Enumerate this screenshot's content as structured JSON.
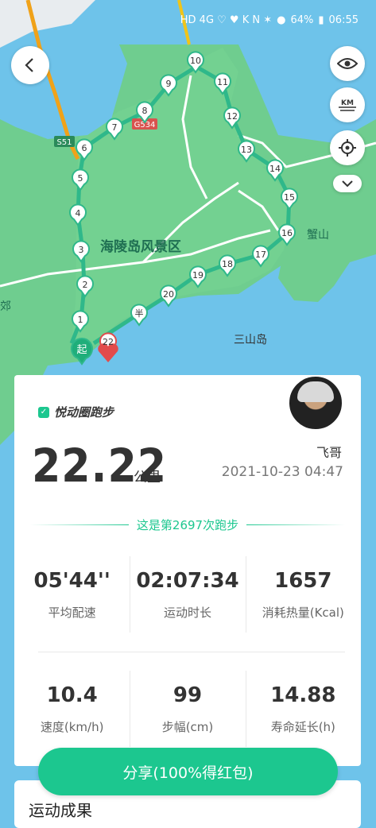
{
  "status_bar": {
    "left_labels": [
      "HD",
      "4G",
      "♡",
      "♥",
      "K",
      "N",
      "✶"
    ],
    "battery": "64%",
    "time": "06:55"
  },
  "map": {
    "route_labels": [
      "起",
      "1",
      "2",
      "3",
      "4",
      "5",
      "6",
      "7",
      "8",
      "9",
      "10",
      "11",
      "12",
      "13",
      "14",
      "15",
      "16",
      "17",
      "18",
      "19",
      "20",
      "半",
      "22"
    ],
    "place_scenic": "海陵岛风景区",
    "place_mountain": "蟹山",
    "place_island": "三山岛",
    "place_edge": "郊",
    "road_s51": "S51",
    "road_g": "G534",
    "route_color": "#2fb88a",
    "land_color": "#6fcd8f",
    "water_color": "#6ec3ea"
  },
  "card": {
    "brand": "悦动圈跑步",
    "distance": "22.22",
    "unit": "公里",
    "username": "飞哥",
    "datetime": "2021-10-23 04:47",
    "run_count": "这是第2697次跑步",
    "stats": [
      {
        "value": "05'44''",
        "label": "平均配速"
      },
      {
        "value": "02:07:34",
        "label": "运动时长"
      },
      {
        "value": "1657",
        "label": "消耗热量(Kcal)"
      },
      {
        "value": "10.4",
        "label": "速度(km/h)"
      },
      {
        "value": "99",
        "label": "步幅(cm)"
      },
      {
        "value": "14.88",
        "label": "寿命延长(h)"
      }
    ]
  },
  "share_button": "分享(100%得红包)",
  "bottom": {
    "title": "运动成果"
  }
}
